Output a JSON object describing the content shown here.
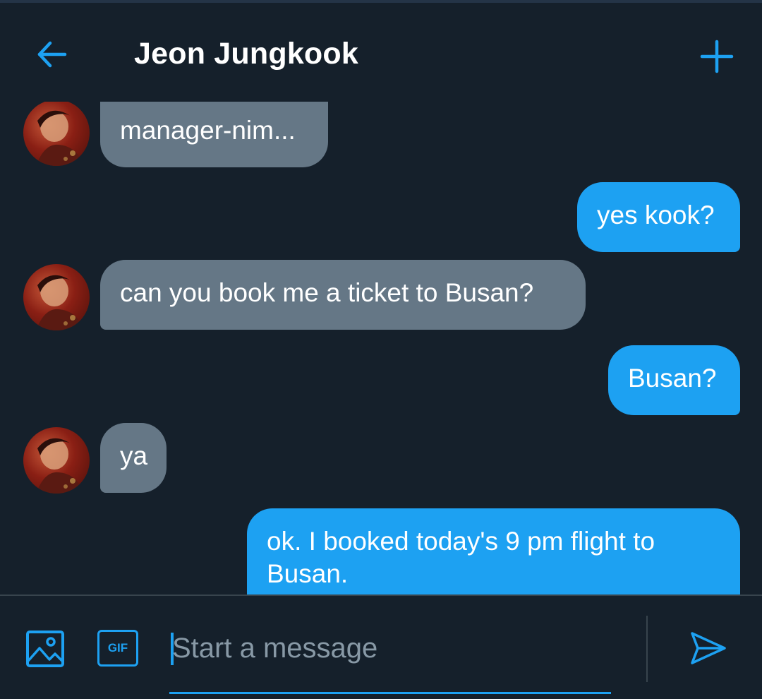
{
  "header": {
    "title": "Jeon Jungkook",
    "back_icon": "arrow-left-icon",
    "new_icon": "plus-icon"
  },
  "messages": [
    {
      "sender": "contact",
      "text": "manager-nim..."
    },
    {
      "sender": "me",
      "text": "yes kook?"
    },
    {
      "sender": "contact",
      "text": "can you book me a ticket to Busan?"
    },
    {
      "sender": "me",
      "text": "Busan?"
    },
    {
      "sender": "contact",
      "text": "ya"
    },
    {
      "sender": "me",
      "text_line1": "ok. I booked today's 9 pm flight to",
      "text_line2": "Busan."
    }
  ],
  "composer": {
    "placeholder": "Start a message",
    "gif_label": "GIF",
    "image_icon": "image-icon",
    "send_icon": "send-icon"
  },
  "colors": {
    "background": "#15202b",
    "accent": "#1da1f2",
    "incoming_bubble": "#657786",
    "outgoing_bubble": "#1da1f2",
    "placeholder": "#8899a6"
  }
}
